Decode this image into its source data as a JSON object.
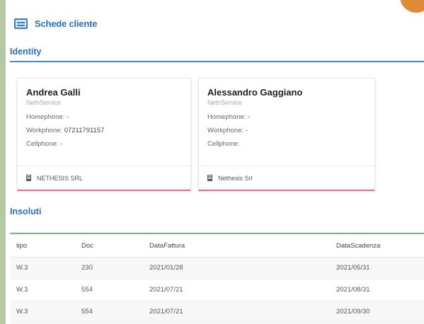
{
  "header": {
    "title": "Schede cliente",
    "icon": "id-card-icon"
  },
  "sections": {
    "identity": {
      "title": "Identity",
      "accent": "#3a8fd6"
    },
    "insoluti": {
      "title": "Insoluti",
      "accent": "#6dc070"
    }
  },
  "contacts": [
    {
      "name": "Andrea Galli",
      "company": "NethService",
      "homephone_label": "Homephone:",
      "homephone": "-",
      "workphone_label": "Workphone:",
      "workphone": "07211791157",
      "cellphone_label": "Cellphone:",
      "cellphone": "-",
      "organization": "NETHESIS SRL"
    },
    {
      "name": "Alessandro Gaggiano",
      "company": "NethService",
      "homephone_label": "Homephone:",
      "homephone": "-",
      "workphone_label": "Workphone:",
      "workphone": "-",
      "cellphone_label": "Cellphone:",
      "cellphone": "",
      "organization": "Nethesis Srl"
    }
  ],
  "table": {
    "headers": [
      "tipo",
      "Doc",
      "DataFattura",
      "DataScadenza"
    ],
    "rows": [
      [
        "W.3",
        "230",
        "2021/01/28",
        "2021/05/31"
      ],
      [
        "W.3",
        "554",
        "2021/07/21",
        "2021/08/31"
      ],
      [
        "W.3",
        "554",
        "2021/07/21",
        "2021/09/30"
      ]
    ]
  },
  "colors": {
    "accent": "#2b6fb8",
    "card_bottom": "#d9747a",
    "background": "#b5c9a6"
  }
}
